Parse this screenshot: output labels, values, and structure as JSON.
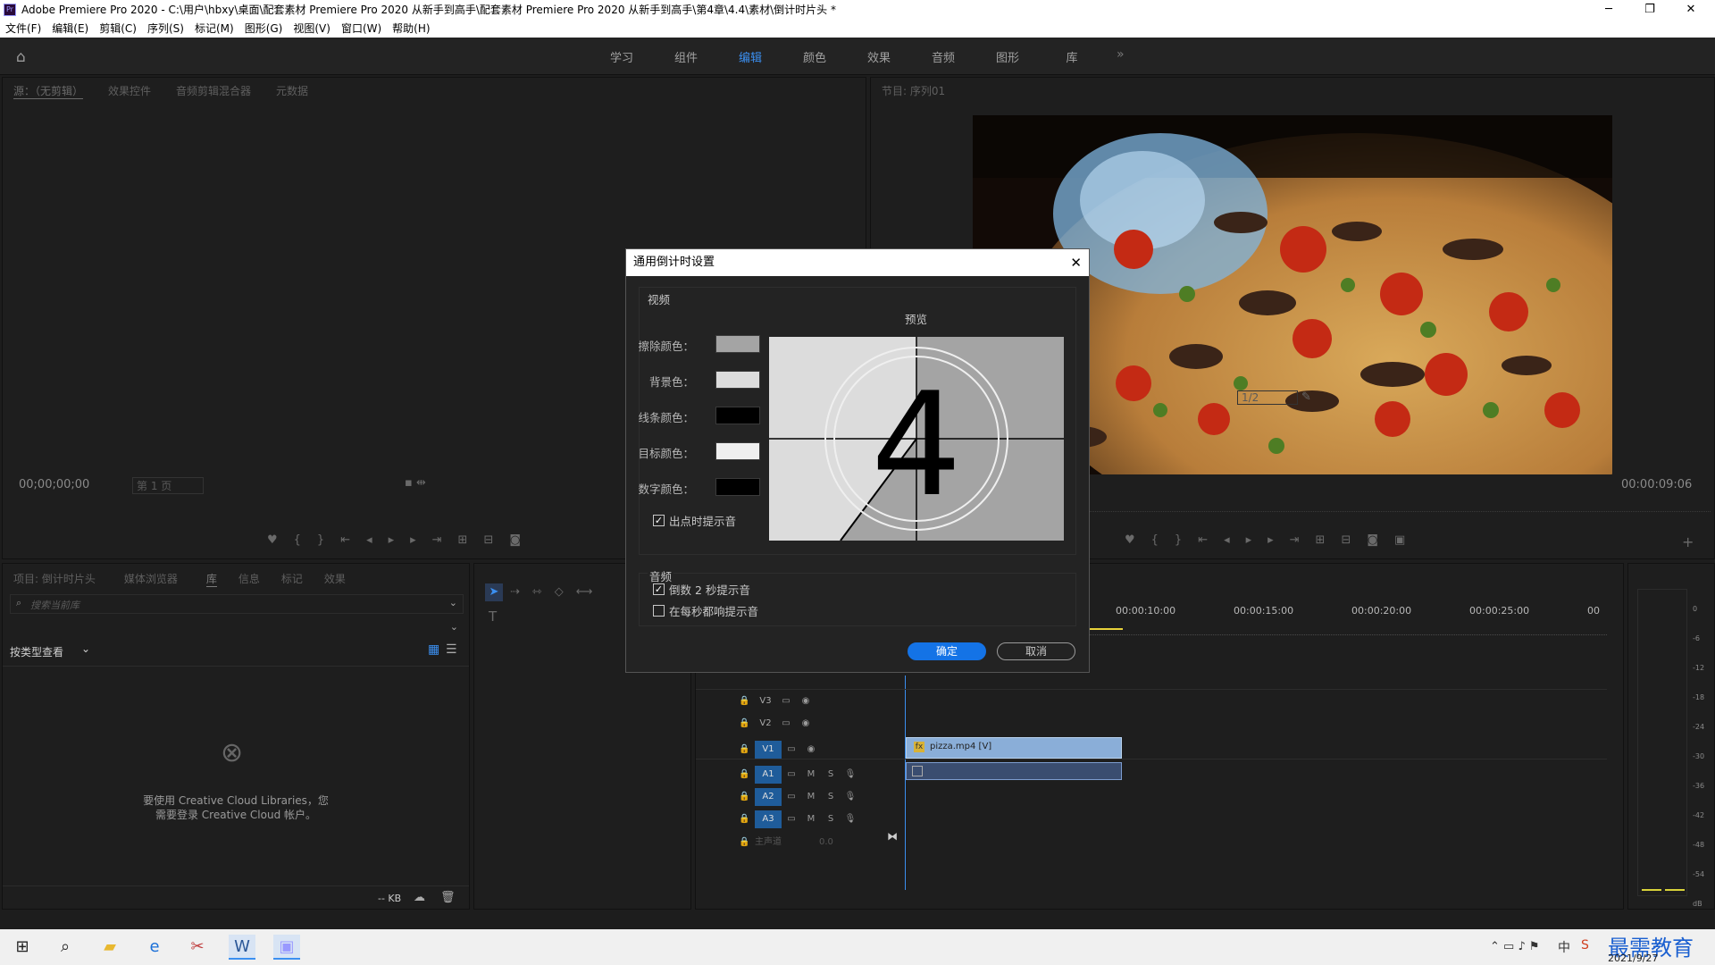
{
  "window": {
    "app_icon": "Pr",
    "title": "Adobe Premiere Pro 2020 - C:\\用户\\hbxy\\桌面\\配套素材 Premiere Pro 2020 从新手到高手\\配套素材 Premiere Pro 2020 从新手到高手\\第4章\\4.4\\素材\\倒计时片头 *",
    "controls": [
      "─",
      "❐",
      "✕"
    ]
  },
  "menu": [
    "文件(F)",
    "编辑(E)",
    "剪辑(C)",
    "序列(S)",
    "标记(M)",
    "图形(G)",
    "视图(V)",
    "窗口(W)",
    "帮助(H)"
  ],
  "workspace_tabs": [
    "学习",
    "组件",
    "编辑",
    "颜色",
    "效果",
    "音频",
    "图形",
    "库"
  ],
  "workspace_active": "编辑",
  "workspace_more": "»",
  "source_panel": {
    "tabs": [
      "源：（无剪辑）",
      "效果控件",
      "音频剪辑混合器",
      "元数据"
    ],
    "timecode": "00;00;00;00",
    "page_select": "第 1 页"
  },
  "program_panel": {
    "tab": "节目: 序列01",
    "zoom": "1/2",
    "timecode": "00:00:09:06"
  },
  "project_panel": {
    "tabs": [
      "项目: 倒计时片头",
      "媒体浏览器",
      "库",
      "信息",
      "标记",
      "效果"
    ],
    "search_placeholder": "搜索当前库",
    "view_by": "按类型查看",
    "cc_message_line1": "要使用 Creative Cloud Libraries，您",
    "cc_message_line2": "需要登录 Creative Cloud 帐户。",
    "storage": "-- KB"
  },
  "timeline": {
    "ruler": [
      "00:00:10:00",
      "00:00:15:00",
      "00:00:20:00",
      "00:00:25:00",
      "00"
    ],
    "video_tracks": [
      "V3",
      "V2",
      "V1"
    ],
    "audio_tracks": [
      "A1",
      "A2",
      "A3"
    ],
    "master": "主声道",
    "master_value": "0.0",
    "clip_name": "pizza.mp4 [V]",
    "fx_badge": "fx"
  },
  "meter": {
    "scale": [
      "0",
      "-6",
      "-12",
      "-18",
      "-24",
      "-30",
      "-36",
      "-42",
      "-48",
      "-54",
      "dB"
    ]
  },
  "dialog": {
    "title": "通用倒计时设置",
    "video_label": "视频",
    "preview_label": "预览",
    "colors": [
      {
        "label": "擦除颜色：",
        "color": "#a4a4a4"
      },
      {
        "label": "背景色：",
        "color": "#dcdcdc"
      },
      {
        "label": "线条颜色：",
        "color": "#000000"
      },
      {
        "label": "目标颜色：",
        "color": "#efefef"
      },
      {
        "label": "数字颜色：",
        "color": "#000000"
      }
    ],
    "cue_checkbox": "出点时提示音",
    "cue_checked": true,
    "preview_digit": "4",
    "audio_label": "音频",
    "audio_options": [
      {
        "label": "倒数 2 秒提示音",
        "checked": true
      },
      {
        "label": "在每秒都响提示音",
        "checked": false
      }
    ],
    "ok": "确定",
    "cancel": "取消"
  },
  "taskbar": {
    "ime": "中",
    "date": "2021/9/27",
    "watermark": "最需教育"
  }
}
